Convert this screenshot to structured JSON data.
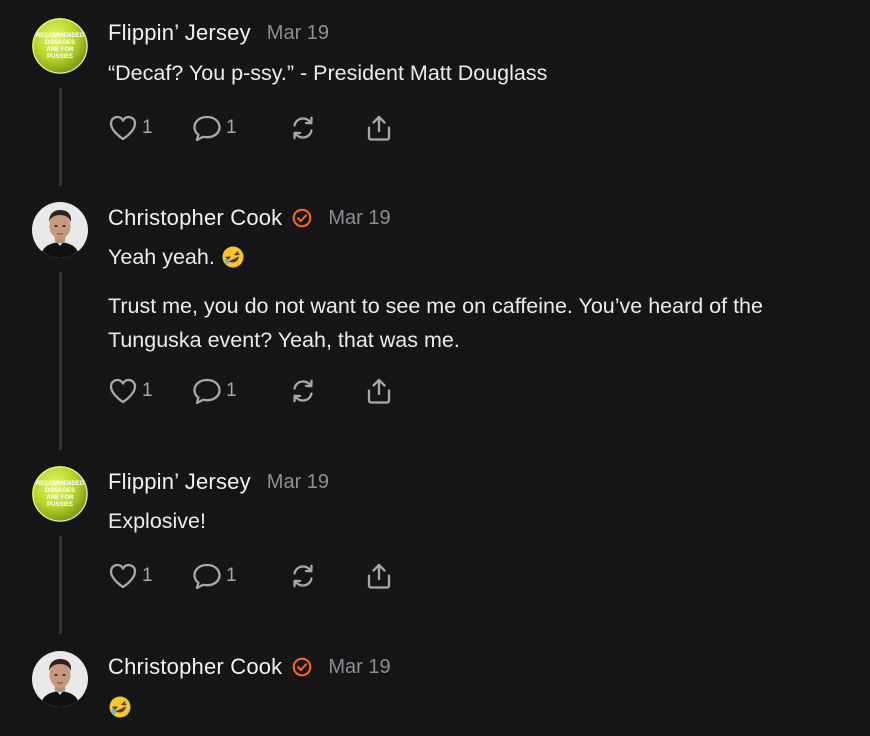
{
  "colors": {
    "background": "#161618",
    "text": "#ececec",
    "muted": "#8e8e93",
    "icon": "#a9a9ad",
    "verified_badge": "#ff6719",
    "thread_line": "#343436"
  },
  "comments": [
    {
      "author": "Flippin’ Jersey",
      "date": "Mar 19",
      "avatar_icon": "green-circle-logo-avatar",
      "avatar_text": [
        "RECOMMENDED",
        "DOSAGES",
        "ARE FOR",
        "PUSSIES"
      ],
      "paragraphs": [
        "“Decaf? You p-ssy.” - President Matt Douglass"
      ],
      "likes": "1",
      "replies": "1"
    },
    {
      "author": "Christopher Cook",
      "verified": true,
      "verified_icon": "verified-badge-icon",
      "date": "Mar 19",
      "avatar_icon": "man-portrait-avatar",
      "paragraphs": [
        "Yeah yeah.",
        "Trust me, you do not want to see me on caffeine. You’ve heard of the Tunguska event? Yeah, that was me."
      ],
      "emoji": "🤣",
      "likes": "1",
      "replies": "1"
    },
    {
      "author": "Flippin’ Jersey",
      "date": "Mar 19",
      "avatar_icon": "green-circle-logo-avatar",
      "avatar_text": [
        "RECOMMENDED",
        "DOSAGES",
        "ARE FOR",
        "PUSSIES"
      ],
      "paragraphs": [
        "Explosive!"
      ],
      "likes": "1",
      "replies": "1"
    },
    {
      "author": "Christopher Cook",
      "verified": true,
      "verified_icon": "verified-badge-icon",
      "date": "Mar 19",
      "avatar_icon": "man-portrait-avatar",
      "paragraphs": [
        ""
      ],
      "emoji": "🤣"
    }
  ],
  "action_icons": [
    "heart-icon",
    "speech-bubble-icon",
    "restack-icon",
    "share-icon"
  ]
}
